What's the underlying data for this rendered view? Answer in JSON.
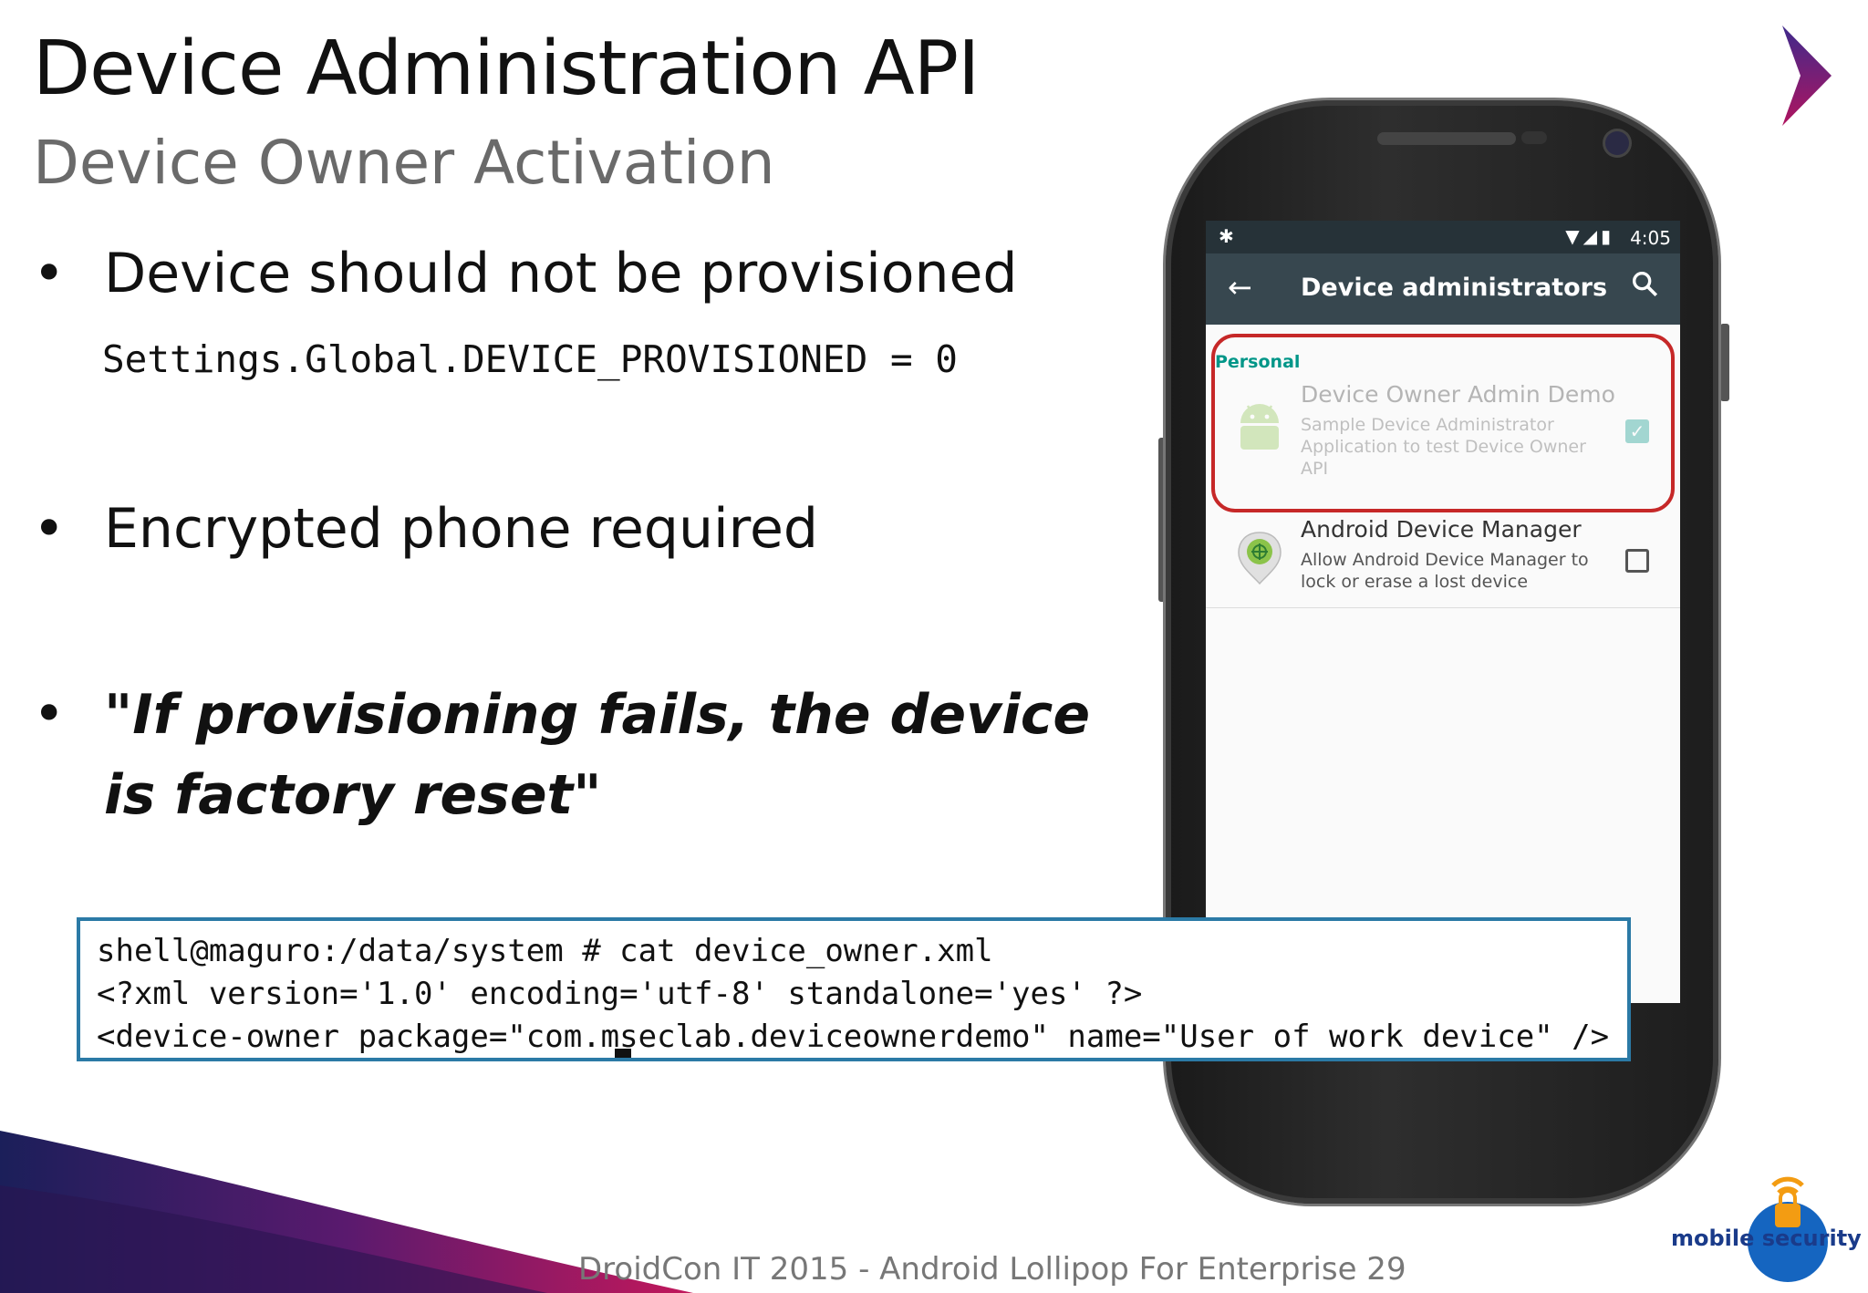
{
  "slide": {
    "title": "Device Administration API",
    "subtitle": "Device Owner Activation",
    "bullet_glyph": "•",
    "bullets": [
      {
        "text": "Device should not be provisioned"
      },
      {
        "text": "Encrypted phone required"
      },
      {
        "text": "\"If provisioning fails, the device is factory reset\""
      }
    ],
    "code": "Settings.Global.DEVICE_PROVISIONED = 0",
    "terminal": {
      "lines": [
        "shell@maguro:/data/system # cat device_owner.xml",
        "<?xml version='1.0' encoding='utf-8' standalone='yes' ?>",
        "<device-owner package=\"com.mseclab.deviceownerdemo\" name=\"User of work device\" />"
      ]
    },
    "footer": "DroidCon IT 2015 - Android Lollipop For Enterprise 29",
    "logo_text": "mobile security lab"
  },
  "phone": {
    "status_time": "4:05",
    "toolbar_title": "Device administrators",
    "icons": {
      "back": "arrow-left-icon",
      "search": "search-icon",
      "debug": "android-debug-icon",
      "wifi": "wifi-icon",
      "signal": "signal-icon",
      "battery": "battery-icon"
    },
    "section_label": "Personal",
    "admins": [
      {
        "name": "Device Owner Admin Demo",
        "description": "Sample Device Administrator Application to test Device Owner API",
        "checked": true
      },
      {
        "name": "Android Device Manager",
        "description": "Allow Android Device Manager to lock or erase a lost device",
        "checked": false
      }
    ]
  },
  "colors": {
    "accent_teal": "#009688",
    "toolbar": "#37474f",
    "status_bar": "#263238",
    "highlight_red": "#c62828",
    "terminal_border": "#2b7aa6",
    "android_green": "#8bc34a"
  }
}
